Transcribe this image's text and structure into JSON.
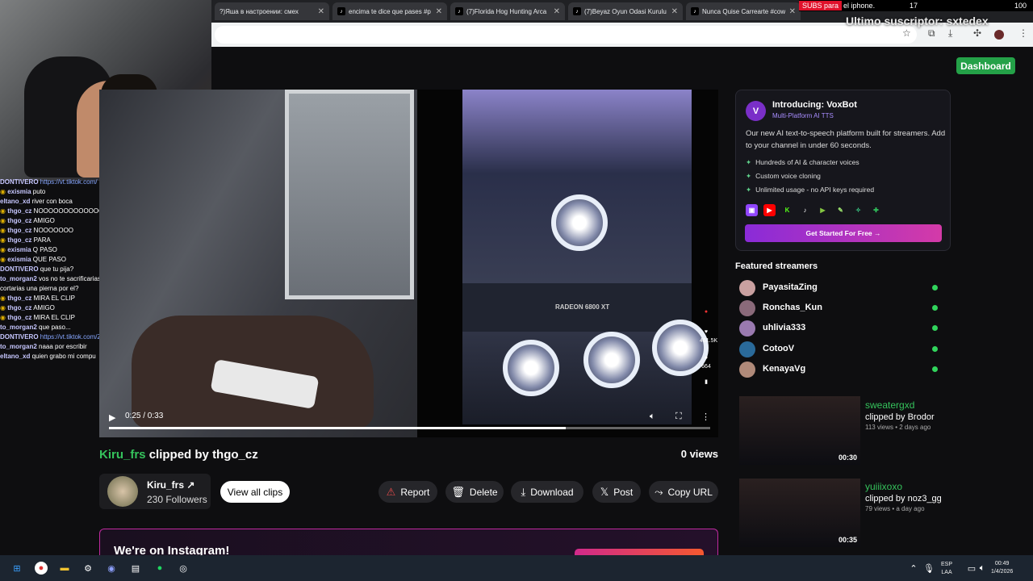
{
  "browser": {
    "tabs": [
      {
        "title": "?)Яша в настроении: смех"
      },
      {
        "title": "encima te dice que pases #p"
      },
      {
        "title": "(7)Florida Hog Hunting Arca"
      },
      {
        "title": "(7)Beyaz Oyun Odasi Kurulu"
      },
      {
        "title": "Nunca Quise Carrearte #cow"
      }
    ],
    "close_glyph": "✕"
  },
  "overlay": {
    "subs_label": "SUBS para",
    "subs_rest": "el iphone.",
    "count_a": "17",
    "count_b": "100",
    "last_sub": "Ultimo suscriptor: sxtedex"
  },
  "chat": [
    {
      "user": "DONTIVERO",
      "msg": "https://vt.tiktok.com/",
      "badge": false,
      "link": true
    },
    {
      "user": "exismia",
      "msg": "puto",
      "badge": true
    },
    {
      "user": "eltano_xd",
      "msg": "river con boca",
      "badge": false
    },
    {
      "user": "thgo_cz",
      "msg": "NOOOOOOOOOOOOOO",
      "badge": true
    },
    {
      "user": "thgo_cz",
      "msg": "AMIGO",
      "badge": true
    },
    {
      "user": "thgo_cz",
      "msg": "NOOOOOOO",
      "badge": true
    },
    {
      "user": "thgo_cz",
      "msg": "PARA",
      "badge": true
    },
    {
      "user": "exismia",
      "msg": "Q PASO",
      "badge": true
    },
    {
      "user": "exismia",
      "msg": "QUE PASO",
      "badge": true
    },
    {
      "user": "DONTIVERO",
      "msg": "que tu pija?",
      "badge": false
    },
    {
      "user": "to_morgan2",
      "msg": "vos no te sacrificarias por un amigo, pero te",
      "badge": false
    },
    {
      "user": "",
      "msg": "cortarias una pierna por el?",
      "badge": false
    },
    {
      "user": "thgo_cz",
      "msg": "MIRA EL CLIP",
      "badge": true
    },
    {
      "user": "thgo_cz",
      "msg": "AMIGO",
      "badge": true
    },
    {
      "user": "thgo_cz",
      "msg": "MIRA EL CLIP",
      "badge": true
    },
    {
      "user": "to_morgan2",
      "msg": "que paso...",
      "badge": false
    },
    {
      "user": "DONTIVERO",
      "msg": "https://vt.tiktok.com/ZSH2SttLe/",
      "badge": false,
      "link": true
    },
    {
      "user": "to_morgan2",
      "msg": "naaa por escribir",
      "badge": false
    },
    {
      "user": "eltano_xd",
      "msg": "quien grabo mi compu",
      "badge": false
    }
  ],
  "header": {
    "dashboard_label": "Dashboard"
  },
  "video": {
    "time_label": "0:25 / 0:33",
    "progress": 0.76,
    "gpu_label": "RADEON 6800 XT",
    "tiktok_likes": "461.5K",
    "tiktok_comments": "664"
  },
  "clip": {
    "creator": "Kiru_frs",
    "clipped_by_text": "clipped by",
    "clipper": "thgo_cz",
    "views": "0 views",
    "channel_name": "Kiru_frs",
    "followers": "230 Followers",
    "view_all_label": "View all clips",
    "actions": {
      "report": "Report",
      "delete": "Delete",
      "download": "Download",
      "post": "Post",
      "copy_url": "Copy URL"
    }
  },
  "instagram": {
    "title": "We're on Instagram!"
  },
  "promo": {
    "logo_letter": "V",
    "title": "Introducing: VoxBot",
    "subtitle": "Multi-Platform AI TTS",
    "description": "Our new AI text-to-speech platform built for streamers. Add to your channel in under 60 seconds.",
    "features": [
      "Hundreds of AI & character voices",
      "Custom voice cloning",
      "Unlimited usage - no API keys required"
    ],
    "cta": "Get Started For Free →"
  },
  "featured": {
    "heading": "Featured streamers",
    "streamers": [
      {
        "name": "PayasitaZing"
      },
      {
        "name": "Ronchas_Kun"
      },
      {
        "name": "uhlivia333"
      },
      {
        "name": "CotooV"
      },
      {
        "name": "KenayaVg"
      }
    ]
  },
  "related_clips": [
    {
      "creator": "sweatergxd",
      "by": "clipped by Brodor",
      "meta": "113 views • 2 days ago",
      "duration": "00:30"
    },
    {
      "creator": "yuiiixoxo",
      "by": "clipped by noz3_gg",
      "meta": "79 views • a day ago",
      "duration": "00:35"
    }
  ],
  "taskbar": {
    "lang_top": "ESP",
    "lang_bottom": "LAA",
    "time": "00:49",
    "date": "1/4/2026"
  }
}
